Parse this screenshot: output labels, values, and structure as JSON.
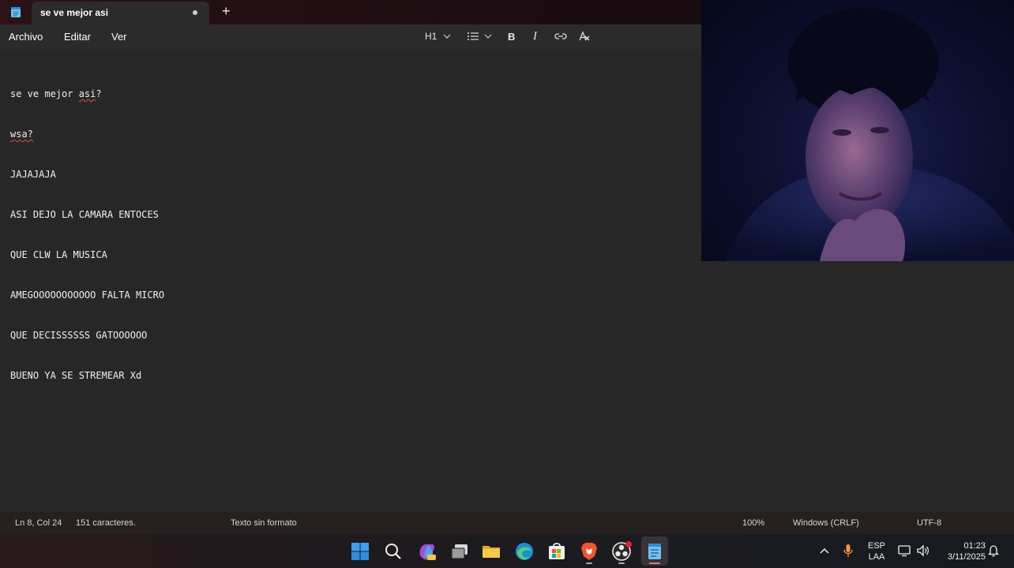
{
  "window": {
    "tab_title": "se ve mejor asi",
    "new_tab_symbol": "+"
  },
  "menu": {
    "file": "Archivo",
    "edit": "Editar",
    "view": "Ver"
  },
  "toolbar": {
    "heading": "H1",
    "bold": "B",
    "italic": "I"
  },
  "editor": {
    "lines": [
      "se ve mejor asi?",
      "wsa?",
      "JAJAJAJA",
      "ASI DEJO LA CAMARA ENTOCES",
      "QUE CLW LA MUSICA",
      "AMEGOOOOOOOOOOO FALTA MICRO",
      "QUE DECISSSSSS GATOOOOOO",
      "BUENO YA SE STREMEAR Xd"
    ],
    "line1_prefix": "se ve mejor ",
    "line1_word": "asi",
    "line1_suffix": "?"
  },
  "status": {
    "position": "Ln 8, Col 24",
    "chars": "151 caracteres.",
    "format": "Texto sin formato",
    "zoom": "100%",
    "line_ending": "Windows (CRLF)",
    "encoding": "UTF-8"
  },
  "taskbar": {
    "icons": [
      "windows-start-icon",
      "search-icon",
      "copilot-icon",
      "task-view-icon",
      "file-explorer-icon",
      "edge-icon",
      "store-icon",
      "brave-icon",
      "obs-icon",
      "notepad-icon"
    ],
    "lang_line1": "ESP",
    "lang_line2": "LAA",
    "time": "01:23",
    "date": "3/11/2025"
  },
  "colors": {
    "accent": "#0a7cd6",
    "brave": "#f2542d",
    "recording": "#e0242f"
  }
}
